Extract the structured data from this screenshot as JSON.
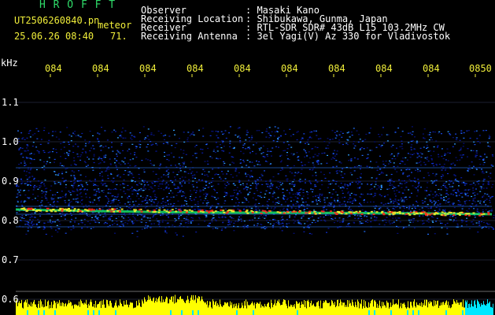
{
  "header": {
    "logo": "H R O F F T",
    "file_name": "UT2506260840.pn",
    "event_label": "meteor",
    "datetime": "25.06.26 08:40",
    "count": "71.",
    "info_labels": [
      "Observer",
      "Receiving Location",
      "Receiver",
      "Receiving Antenna"
    ],
    "info_values": [
      ": Masaki Kano",
      ": Shibukawa, Gunma, Japan",
      ": RTL-SDR SDR# 43dB L15 103.2MHz CW",
      ": 3el Yagi(V) Az 330 for Vladivostok"
    ]
  },
  "y_axis": {
    "unit": "kHz",
    "ticks": [
      "1.1",
      "1.0",
      "0.9",
      "0.8",
      "0.7",
      "0.6"
    ]
  },
  "x_axis": {
    "ticks": [
      "084",
      "084",
      "084",
      "084",
      "084",
      "084",
      "084",
      "084",
      "084",
      "0850"
    ]
  },
  "colors": {
    "background": "#000000",
    "text_header": "#ffffff",
    "text_axis": "#f0ee3a",
    "logo": "#2fdc6a",
    "noise_bar": "#ffff00",
    "noise_bar_alt": "#00e8ff",
    "echo_strong": "#ff2a1a",
    "echo_mid": "#19e06a"
  }
}
